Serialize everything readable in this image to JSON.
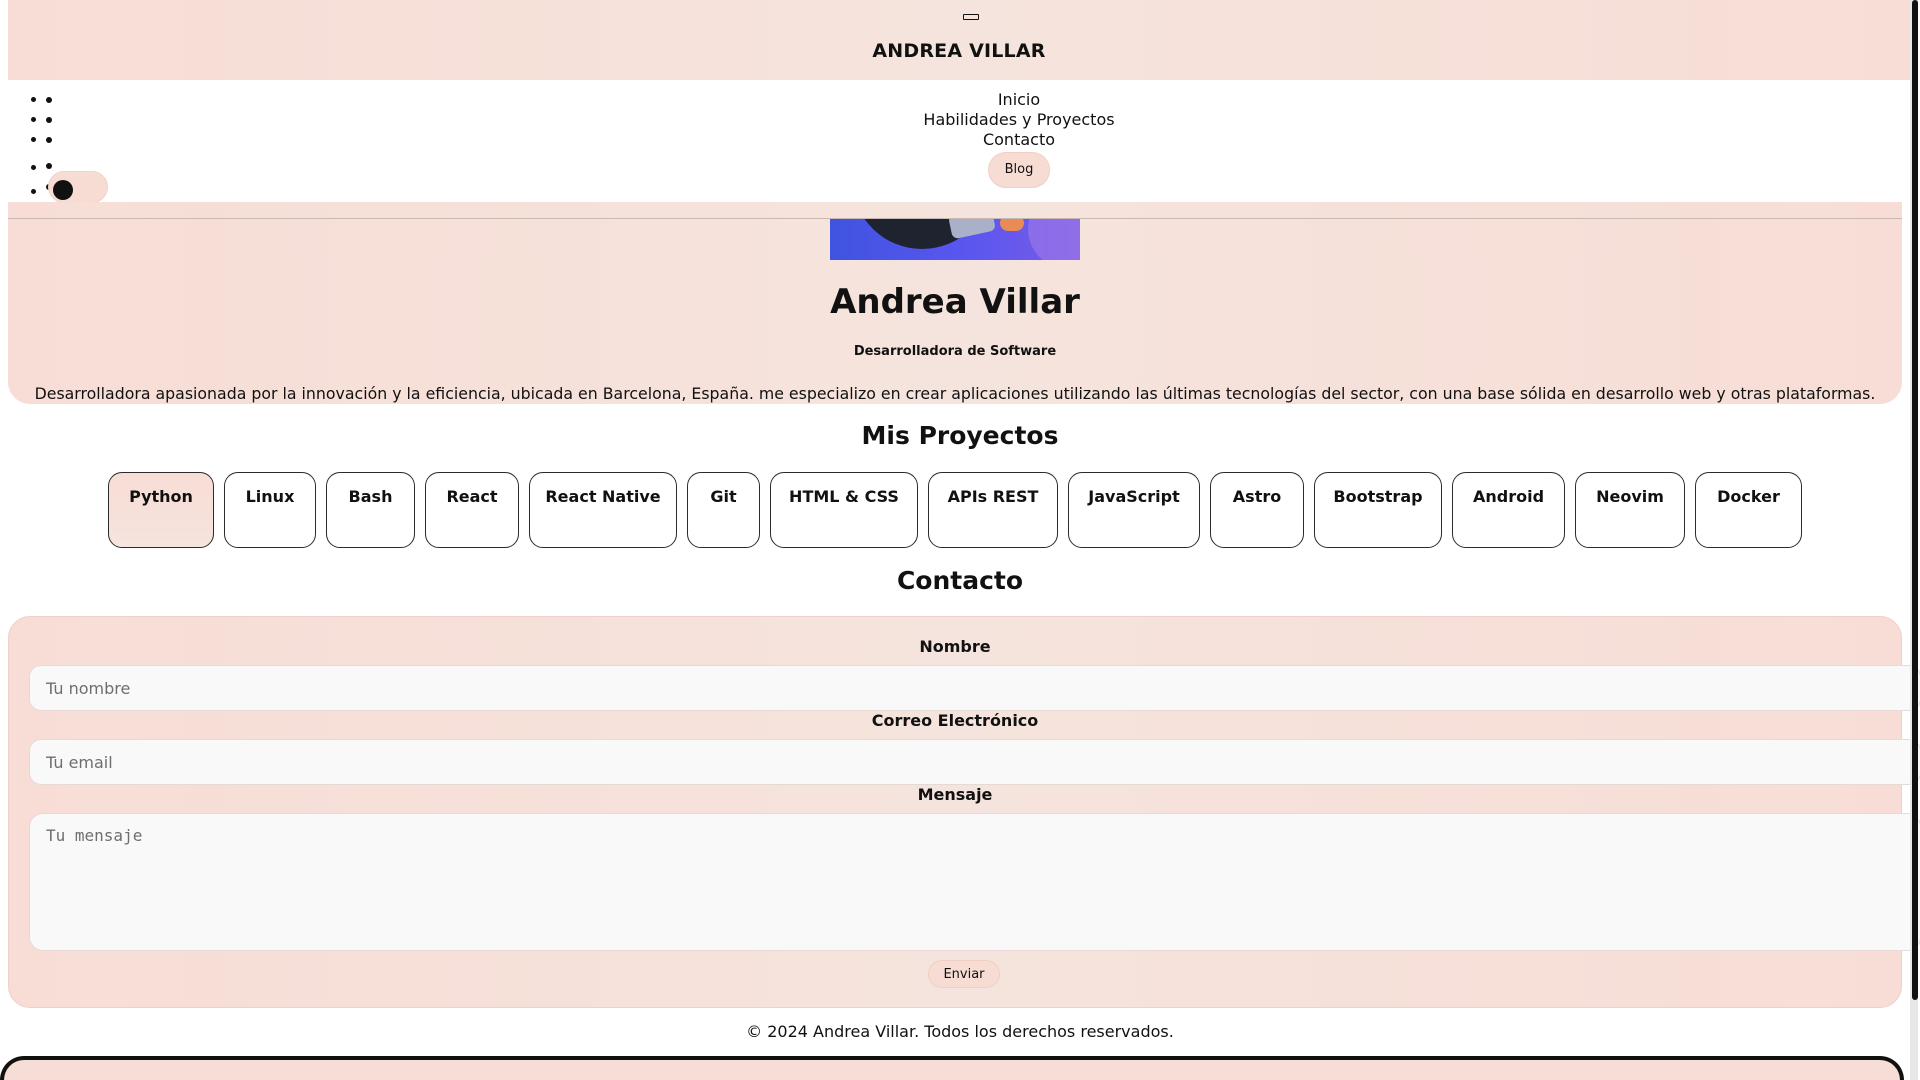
{
  "header": {
    "title": "ANDREA VILLAR"
  },
  "nav": {
    "items": [
      {
        "label": "Inicio"
      },
      {
        "label": "Habilidades y Proyectos"
      },
      {
        "label": "Contacto"
      }
    ],
    "blog_label": "Blog"
  },
  "hero": {
    "name": "Andrea Villar",
    "role": "Desarrolladora de Software",
    "description": "Desarrolladora apasionada por la innovación y la eficiencia, ubicada en Barcelona, España. me especializo en crear aplicaciones utilizando las últimas tecnologías del sector, con una base sólida en desarrollo web y otras plataformas."
  },
  "projects": {
    "title": "Mis Proyectos",
    "tags": [
      {
        "label": "Python",
        "active": true
      },
      {
        "label": "Linux"
      },
      {
        "label": "Bash"
      },
      {
        "label": "React"
      },
      {
        "label": "React Native"
      },
      {
        "label": "Git"
      },
      {
        "label": "HTML & CSS"
      },
      {
        "label": "APIs REST"
      },
      {
        "label": "JavaScript"
      },
      {
        "label": "Astro"
      },
      {
        "label": "Bootstrap"
      },
      {
        "label": "Android"
      },
      {
        "label": "Neovim"
      },
      {
        "label": "Docker"
      }
    ]
  },
  "contact": {
    "title": "Contacto",
    "name_label": "Nombre",
    "name_placeholder": "Tu nombre",
    "email_label": "Correo Electrónico",
    "email_placeholder": "Tu email",
    "message_label": "Mensaje",
    "message_placeholder": "Tu mensaje",
    "send_label": "Enviar"
  },
  "footer": {
    "text": "© 2024 Andrea Villar. Todos los derechos reservados."
  },
  "colors": {
    "accent_peach": "#f6dcd3",
    "text_dark": "#111111",
    "hero_image_blue": "#4f56f0"
  },
  "icons": {
    "menu": "hamburger-icon",
    "theme_toggle": "theme-toggle-icon"
  }
}
